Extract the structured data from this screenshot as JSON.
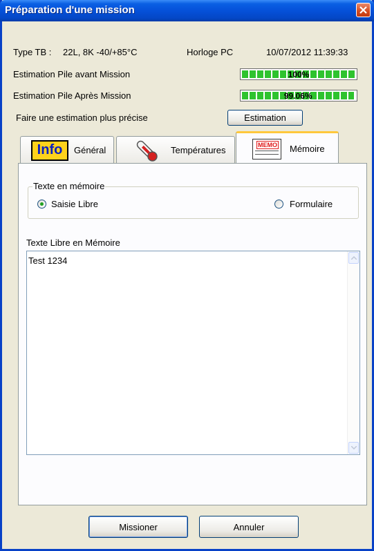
{
  "window": {
    "title": "Préparation d'une mission"
  },
  "info": {
    "type_label": "Type TB :",
    "type_value": "22L, 8K -40/+85°C",
    "clock_label": "Horloge PC",
    "clock_value": "10/07/2012 11:39:33"
  },
  "battery": {
    "before_label": "Estimation Pile avant Mission",
    "before_percent": 100,
    "before_text": "100%",
    "after_label": "Estimation Pile Après Mission",
    "after_percent": 99.06,
    "after_text": "99.06%"
  },
  "estimate": {
    "label": "Faire une estimation plus précise",
    "button": "Estimation"
  },
  "tabs": [
    {
      "label": "Général",
      "icon": "info-icon"
    },
    {
      "label": "Températures",
      "icon": "thermometer-icon"
    },
    {
      "label": "Mémoire",
      "icon": "memo-icon",
      "icon_text": "MEMO"
    }
  ],
  "active_tab": "Mémoire",
  "info_icon_text": "Info",
  "memory": {
    "group_label": "Texte en mémoire",
    "option_free": "Saisie Libre",
    "option_form": "Formulaire",
    "selected": "Saisie Libre",
    "text_label": "Texte Libre en Mémoire",
    "text_value": "Test 1234"
  },
  "buttons": {
    "submit": "Missioner",
    "cancel": "Annuler"
  },
  "colors": {
    "titlebar": "#0551d9",
    "progress": "#2ec32e",
    "tab_highlight": "#ffc83c",
    "close": "#d44b1f"
  }
}
